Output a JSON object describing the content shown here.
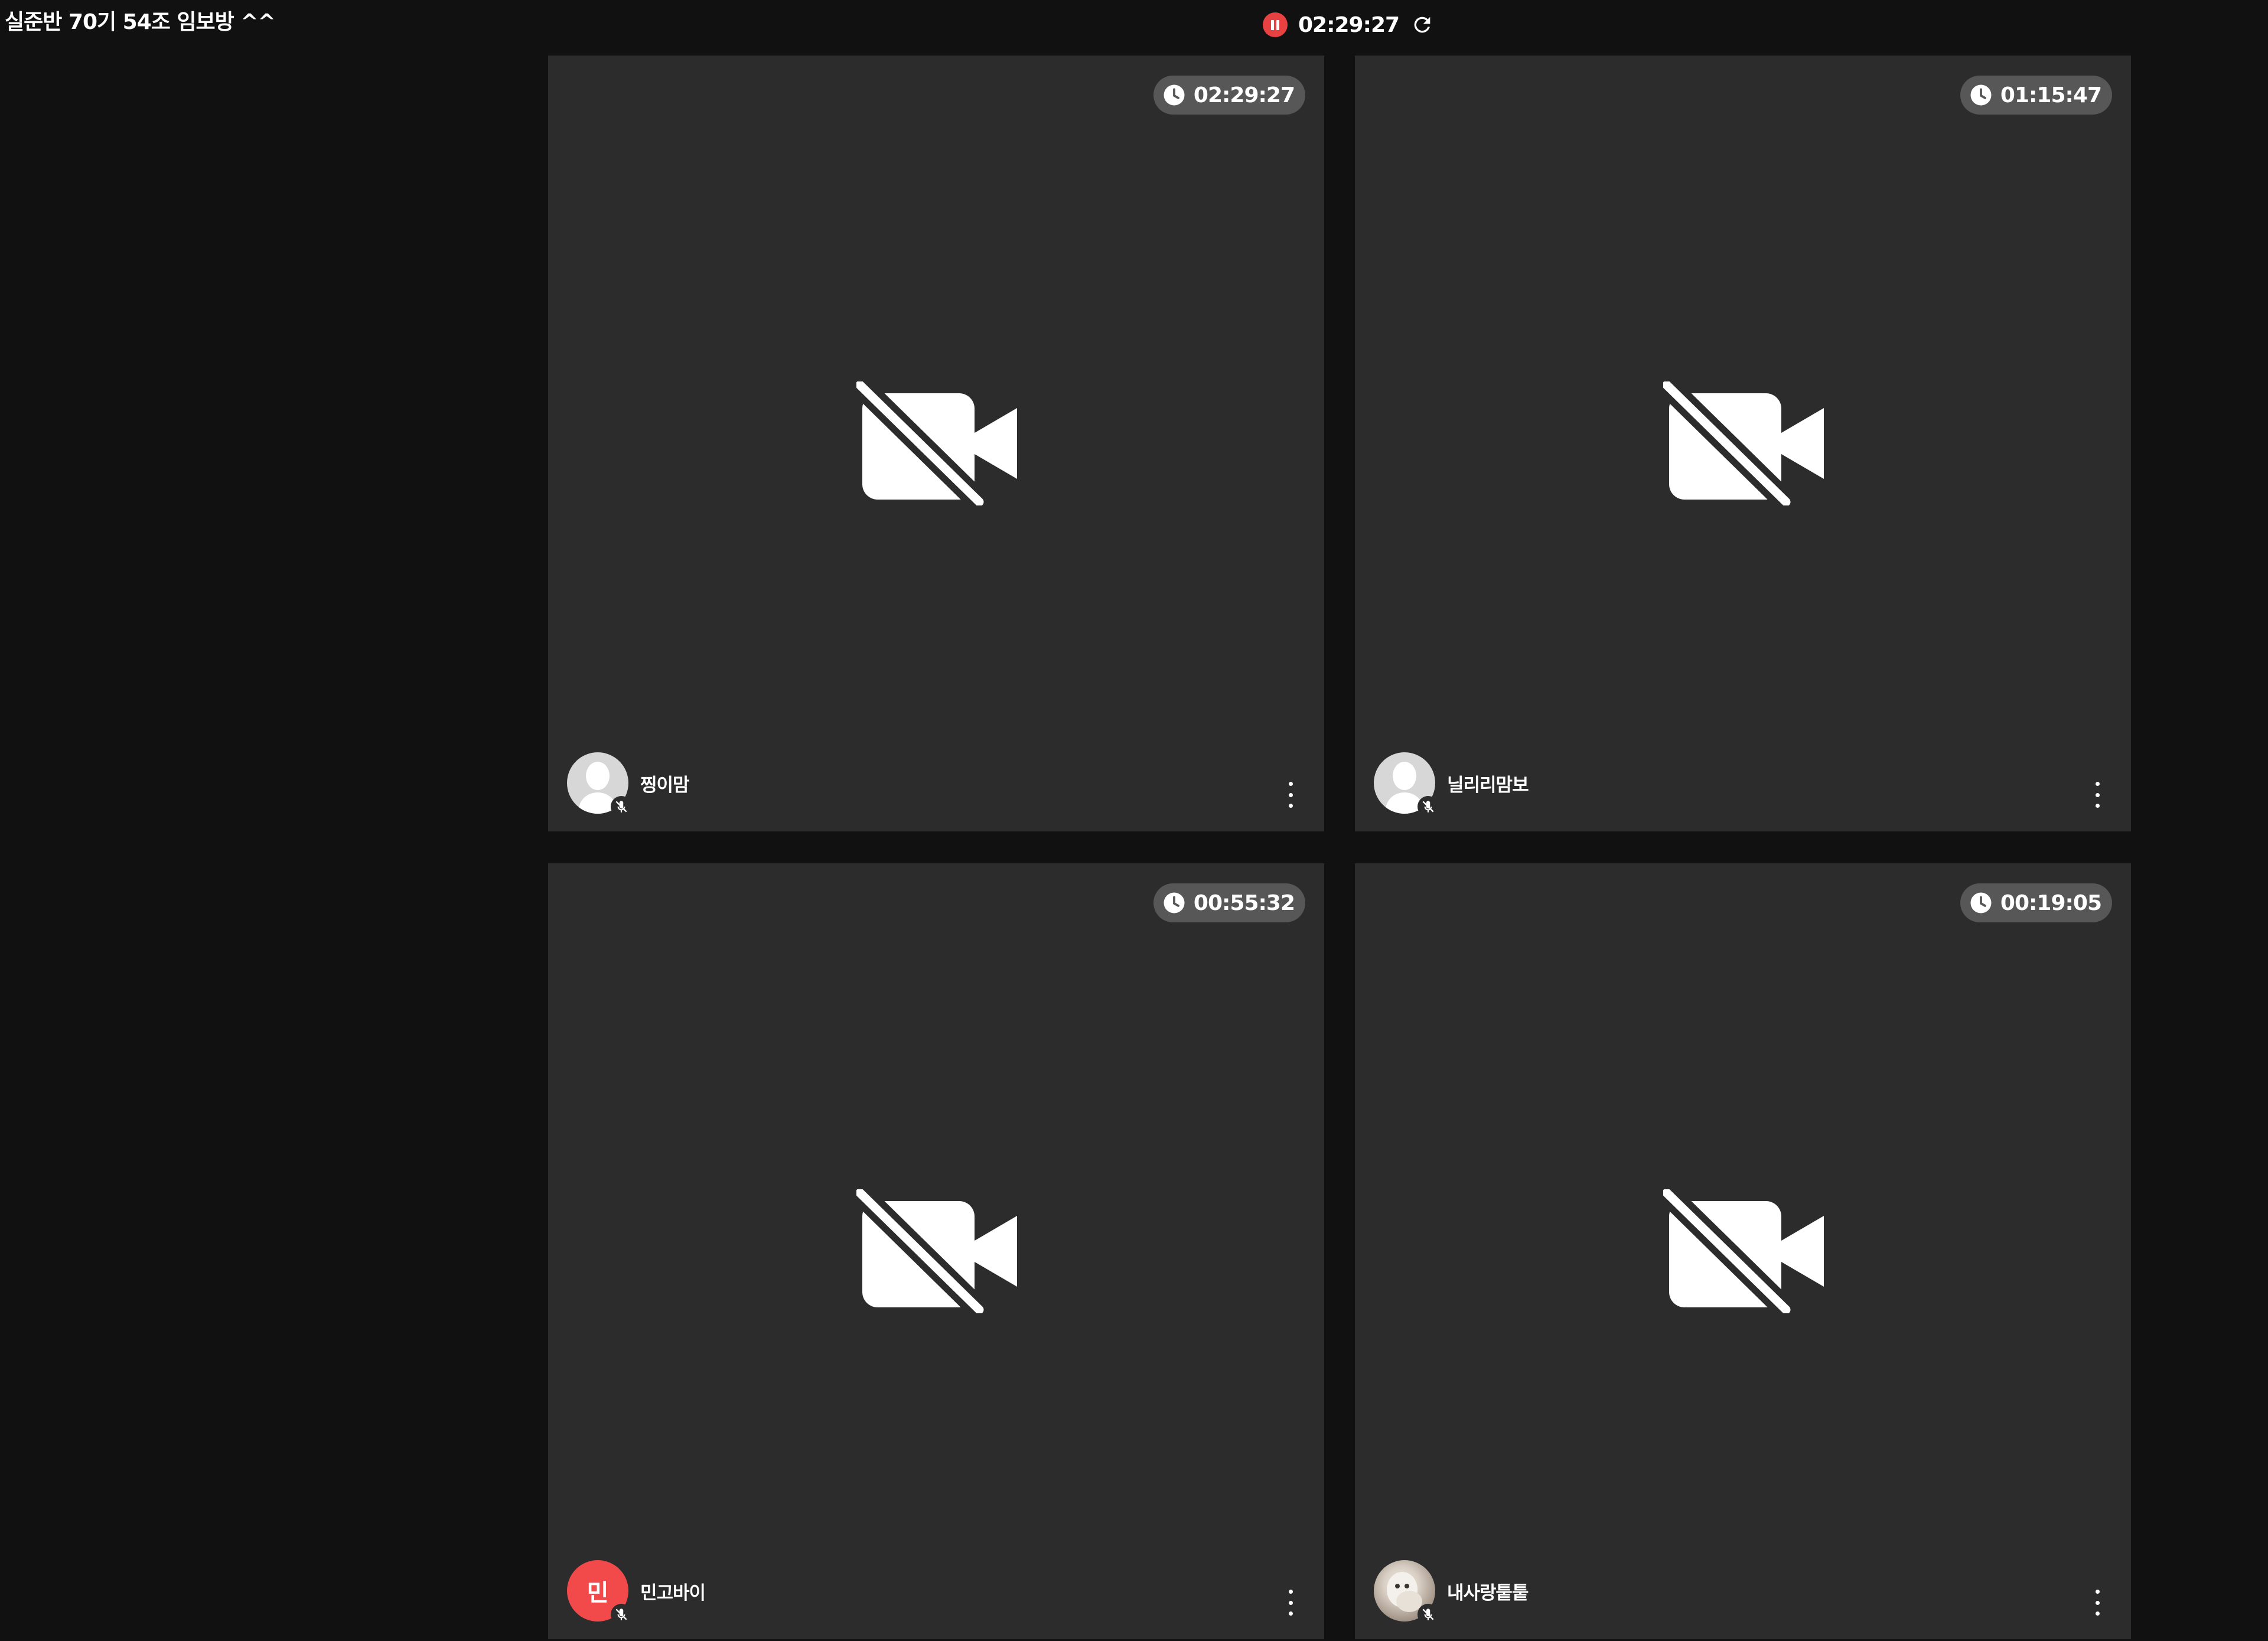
{
  "room": {
    "title": "실준반 70기 54조 임보방 ^^"
  },
  "session": {
    "status_icon": "pause-record-icon",
    "elapsed": "02:29:27",
    "refresh_icon": "refresh-icon"
  },
  "participants": [
    {
      "name": "찡이맘",
      "timer": "02:29:27",
      "avatar_type": "default",
      "avatar_initial": "",
      "mic": "muted",
      "camera": "off"
    },
    {
      "name": "닐리리맘보",
      "timer": "01:15:47",
      "avatar_type": "default",
      "avatar_initial": "",
      "mic": "muted",
      "camera": "off"
    },
    {
      "name": "민고바이",
      "timer": "00:55:32",
      "avatar_type": "initial",
      "avatar_initial": "민",
      "mic": "muted",
      "camera": "off"
    },
    {
      "name": "내사랑퉅퉅",
      "timer": "00:19:05",
      "avatar_type": "photo",
      "avatar_initial": "",
      "mic": "muted",
      "camera": "off"
    }
  ],
  "colors": {
    "background": "#111111",
    "tile": "#2c2c2c",
    "badge": "#575757",
    "record": "#e84141",
    "initial_avatar": "#f24a4a"
  }
}
